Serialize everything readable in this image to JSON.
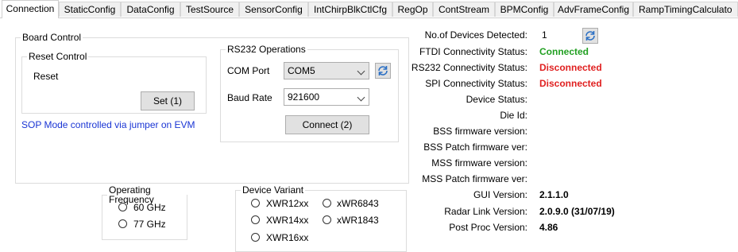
{
  "tabs": [
    "Connection",
    "StaticConfig",
    "DataConfig",
    "TestSource",
    "SensorConfig",
    "IntChirpBlkCtlCfg",
    "RegOp",
    "ContStream",
    "BPMConfig",
    "AdvFrameConfig",
    "RampTimingCalculato"
  ],
  "board_control": {
    "title": "Board Control",
    "reset_control": {
      "title": "Reset Control",
      "reset_label": "Reset",
      "set_button": "Set (1)"
    },
    "sop_note": "SOP Mode controlled via jumper on EVM"
  },
  "rs232": {
    "title": "RS232 Operations",
    "com_port_label": "COM Port",
    "com_port_value": "COM5",
    "baud_rate_label": "Baud Rate",
    "baud_rate_value": "921600",
    "connect_button": "Connect (2)"
  },
  "operating_frequency": {
    "title": "Operating Frequency",
    "options": [
      "60 GHz",
      "77 GHz"
    ]
  },
  "device_variant": {
    "title": "Device Variant",
    "options": [
      "XWR12xx",
      "xWR6843",
      "XWR14xx",
      "xWR1843",
      "XWR16xx"
    ]
  },
  "status": {
    "devices_detected_label": "No.of Devices Detected:",
    "devices_detected_value": "1",
    "rows": [
      {
        "label": "FTDI Connectivity Status:",
        "value": "Connected",
        "color": "#22a022"
      },
      {
        "label": "RS232 Connectivity Status:",
        "value": "Disconnected",
        "color": "#e02020"
      },
      {
        "label": "SPI Connectivity Status:",
        "value": "Disconnected",
        "color": "#e02020"
      },
      {
        "label": "Device Status:",
        "value": ""
      },
      {
        "label": "Die Id:",
        "value": ""
      },
      {
        "label": "BSS firmware version:",
        "value": ""
      },
      {
        "label": "BSS Patch firmware ver:",
        "value": ""
      },
      {
        "label": "MSS firmware version:",
        "value": ""
      },
      {
        "label": "MSS Patch firmware ver:",
        "value": ""
      },
      {
        "label": "GUI Version:",
        "value": "2.1.1.0"
      },
      {
        "label": "Radar Link Version:",
        "value": "2.0.9.0 (31/07/19)"
      },
      {
        "label": "Post Proc Version:",
        "value": "4.86"
      }
    ]
  }
}
